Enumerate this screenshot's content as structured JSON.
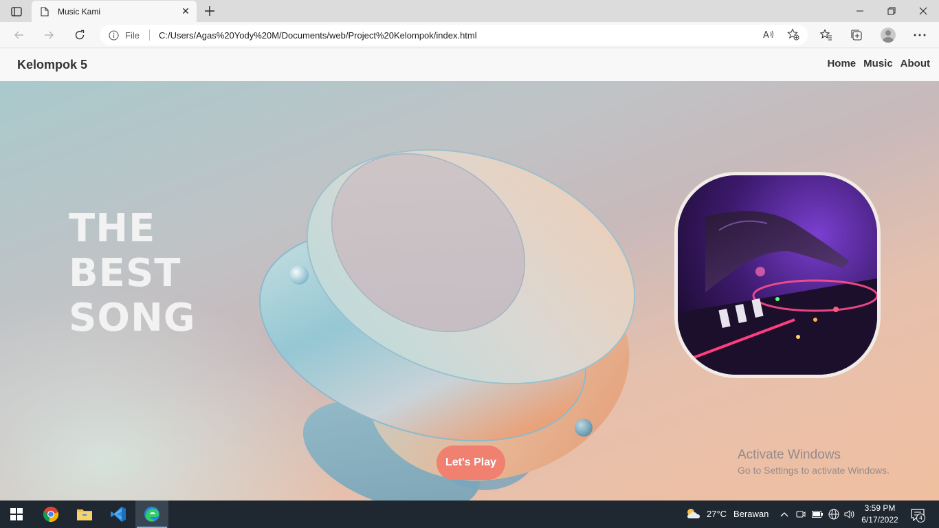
{
  "browser": {
    "tab": {
      "title": "Music Kami",
      "icon": "page-icon"
    },
    "address": {
      "scheme_label": "File",
      "url": "C:/Users/Agas%20Yody%20M/Documents/web/Project%20Kelompok/index.html"
    }
  },
  "site": {
    "brand": "Kelompok 5",
    "nav": {
      "home": "Home",
      "music": "Music",
      "about": "About"
    },
    "hero": {
      "title_lines": [
        "THE",
        "BEST",
        "SONG"
      ],
      "cta_label": "Let's Play"
    },
    "colors": {
      "cta": "#f08070",
      "nav_bg": "#f8f8f8",
      "hero_text": "#f2f2f2"
    }
  },
  "watermark": {
    "title": "Activate Windows",
    "subtitle": "Go to Settings to activate Windows."
  },
  "taskbar": {
    "apps": [
      "windows-start-icon",
      "chrome-icon",
      "file-explorer-icon",
      "vscode-icon",
      "edge-icon"
    ],
    "weather": {
      "temp": "27°C",
      "condition": "Berawan"
    },
    "clock": {
      "time": "3:59 PM",
      "date": "6/17/2022"
    },
    "notifications": "4"
  }
}
